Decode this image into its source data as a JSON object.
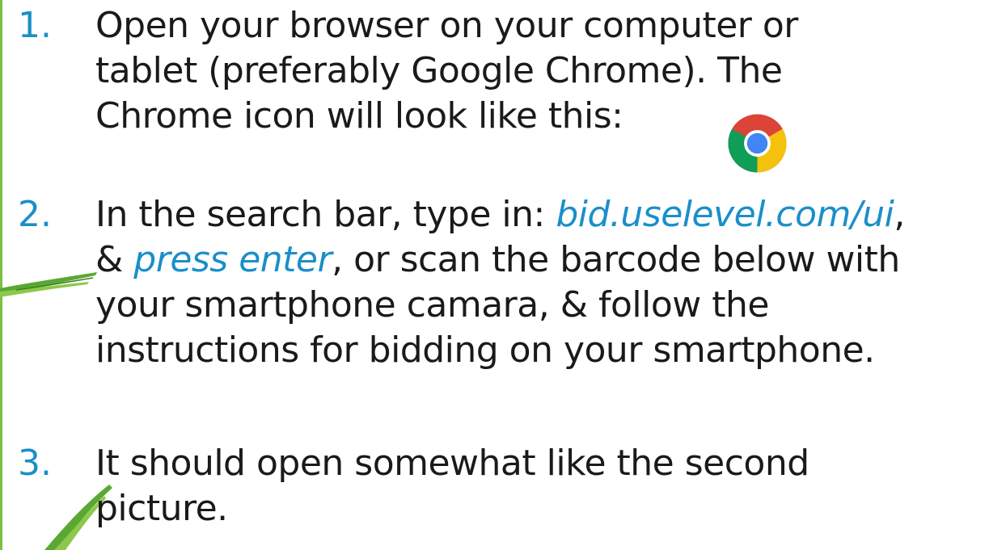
{
  "steps": [
    {
      "number": "1.",
      "lines": [
        "Open your browser on your computer or",
        "tablet (preferably Google Chrome). The",
        "Chrome icon will look like this:"
      ]
    },
    {
      "number": "2.",
      "line1_a": "In the search bar, type in: ",
      "line1_link": "bid.uselevel.com/ui",
      "line1_b": ",",
      "line2_a": "& ",
      "line2_em": "press enter",
      "line2_b": ", or scan the barcode below with",
      "line3": "your smartphone camara, & follow the",
      "line4": "instructions for bidding on your smartphone."
    },
    {
      "number": "3.",
      "lines": [
        "It should open somewhat like the second",
        "picture."
      ]
    }
  ],
  "icons": {
    "chrome": "chrome-icon"
  },
  "colors": {
    "number": "#1a8fc9",
    "text": "#1a1a1a",
    "accent_green": "#7ac143"
  }
}
